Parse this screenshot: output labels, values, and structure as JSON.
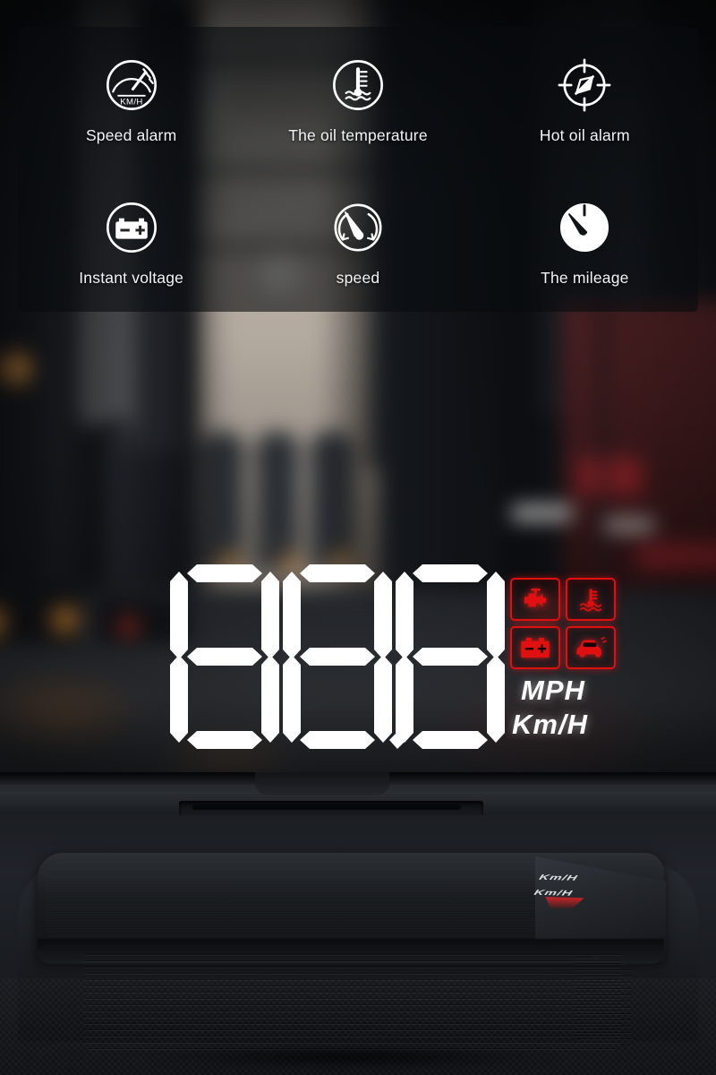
{
  "features": [
    {
      "id": "speed-alarm",
      "label": "Speed alarm",
      "icon": "speedometer-kmh-icon"
    },
    {
      "id": "oil-temperature",
      "label": "The oil temperature",
      "icon": "coolant-thermometer-icon"
    },
    {
      "id": "hot-oil-alarm",
      "label": "Hot oil alarm",
      "icon": "compass-crosshair-icon"
    },
    {
      "id": "instant-voltage",
      "label": "Instant voltage",
      "icon": "battery-icon"
    },
    {
      "id": "speed",
      "label": "speed",
      "icon": "gauge-needle-icon"
    },
    {
      "id": "mileage",
      "label": "The mileage",
      "icon": "odometer-dial-icon"
    }
  ],
  "hud_display": {
    "digits": [
      "8",
      "8",
      "8"
    ],
    "decimal_point": ".",
    "segments_on": "all",
    "units": {
      "primary": "MPH",
      "secondary": "Km/H"
    },
    "digit_color": "#ffffff",
    "warning_color": "#e01010",
    "telltales": [
      {
        "id": "check-engine",
        "icon": "engine-warning-icon"
      },
      {
        "id": "coolant-temp",
        "icon": "coolant-warning-icon"
      },
      {
        "id": "battery-voltage",
        "icon": "battery-warning-icon"
      },
      {
        "id": "vehicle-alert",
        "icon": "car-warning-icon"
      }
    ]
  },
  "device": {
    "reflection_line_1": "Km/H",
    "reflection_line_2": "Km/H"
  },
  "colors": {
    "panel_bg": "#090b0f",
    "label_text": "#f2f4f6",
    "hud_white": "#ffffff",
    "hud_red": "#e01010"
  }
}
